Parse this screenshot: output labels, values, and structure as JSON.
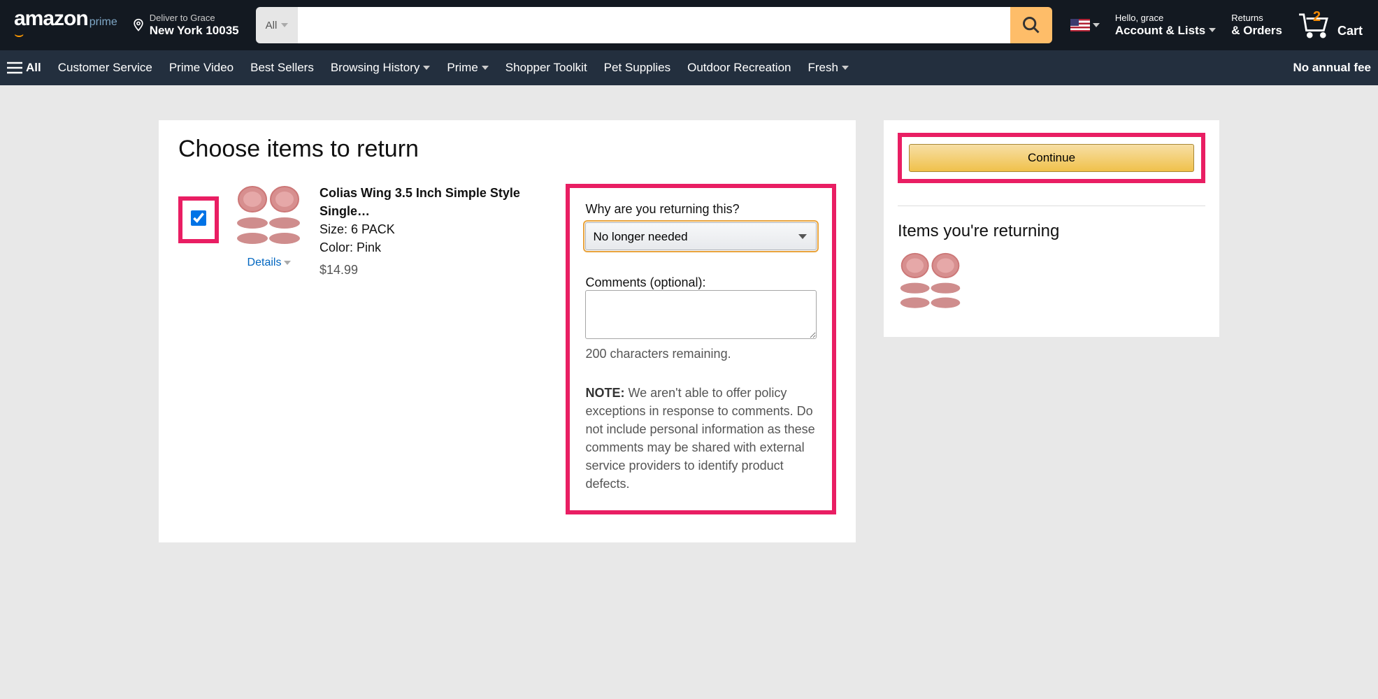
{
  "header": {
    "logo_text": "amazon",
    "logo_sub": "prime",
    "deliver_l1": "Deliver to Grace",
    "deliver_l2": "New York 10035",
    "search_cat": "All",
    "hello": "Hello, grace",
    "account": "Account & Lists",
    "returns_l1": "Returns",
    "returns_l2": "& Orders",
    "cart_count": "2",
    "cart_label": "Cart"
  },
  "subnav": {
    "all": "All",
    "items": [
      "Customer Service",
      "Prime Video",
      "Best Sellers",
      "Browsing History",
      "Prime",
      "Shopper Toolkit",
      "Pet Supplies",
      "Outdoor Recreation",
      "Fresh"
    ],
    "promo": "No annual fee"
  },
  "page": {
    "title": "Choose items to return",
    "item": {
      "name": "Colias Wing 3.5 Inch Simple Style Single…",
      "size_label": "Size: 6 PACK",
      "color_label": "Color: Pink",
      "price": "$14.99",
      "details": "Details"
    },
    "reason": {
      "q": "Why are you returning this?",
      "selected": "No longer needed",
      "comments_label": "Comments (optional):",
      "remaining": "200 characters remaining.",
      "note_bold": "NOTE:",
      "note_text": " We aren't able to offer policy exceptions in response to comments. Do not include personal information as these comments may be shared with external service providers to identify product defects."
    },
    "right": {
      "continue": "Continue",
      "returning_h": "Items you're returning"
    }
  }
}
